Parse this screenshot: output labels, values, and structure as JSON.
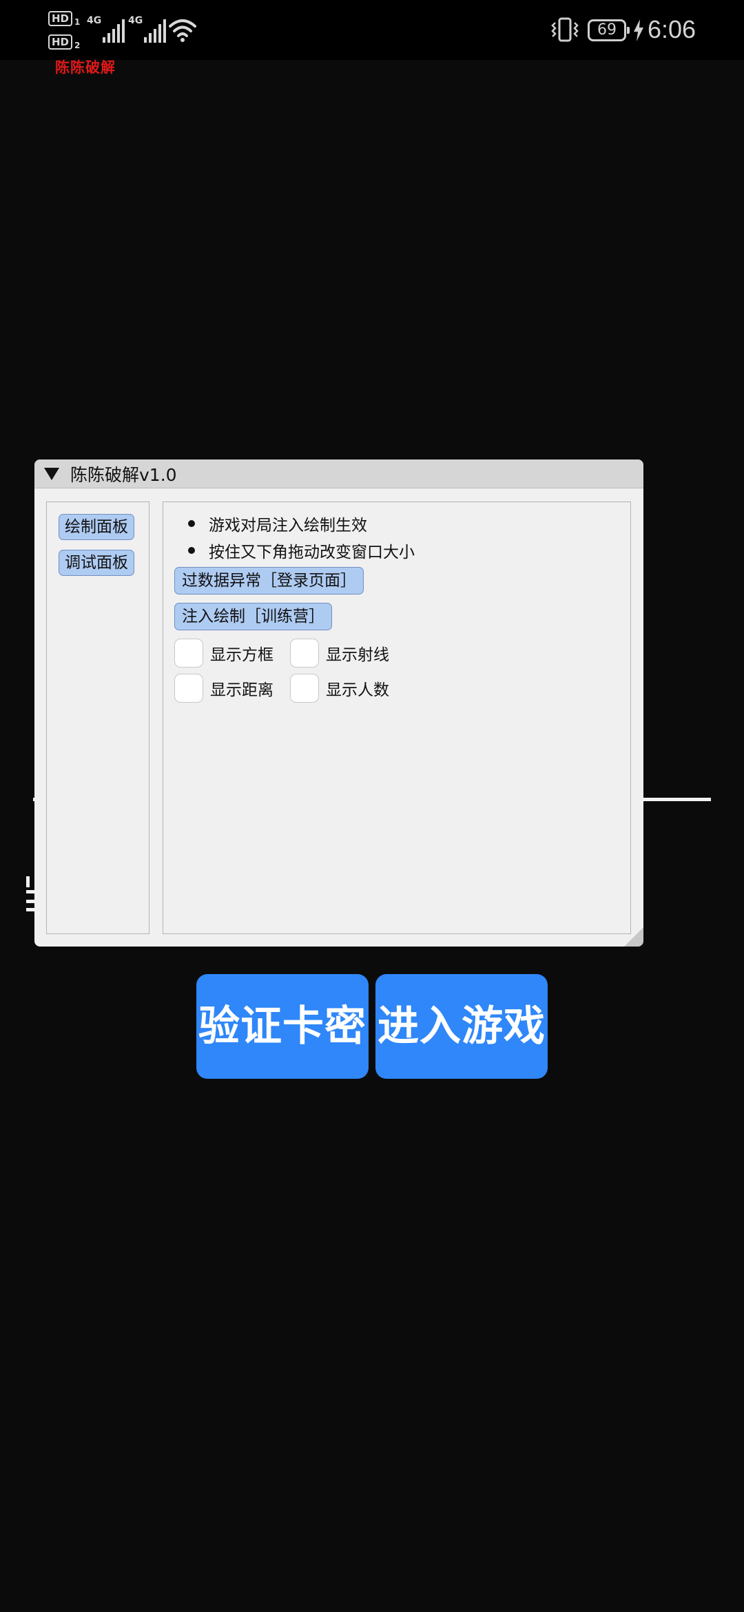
{
  "status_bar": {
    "hd1": "HD",
    "hd1_num": "1",
    "hd2": "HD",
    "hd2_num": "2",
    "sim1_network": "4G",
    "sim2_network": "4G",
    "battery_level": "69",
    "time": "6:06",
    "icons": [
      "signal-icon",
      "wifi-icon",
      "vibrate-icon",
      "battery-icon",
      "charging-icon"
    ],
    "overlay_text": "陈陈破解"
  },
  "window": {
    "title": "陈陈破解v1.0",
    "sidebar": {
      "items": [
        {
          "label": "绘制面板"
        },
        {
          "label": "调试面板"
        }
      ]
    },
    "notes": [
      "游戏对局注入绘制生效",
      "按住又下角拖动改变窗口大小"
    ],
    "buttons": {
      "bypass": "过数据异常［登录页面］",
      "inject": "注入绘制［训练营］"
    },
    "options": [
      {
        "label": "显示方框",
        "checked": false
      },
      {
        "label": "显示射线",
        "checked": false
      },
      {
        "label": "显示距离",
        "checked": false
      },
      {
        "label": "显示人数",
        "checked": false
      }
    ]
  },
  "actions": {
    "verify_label": "验证卡密",
    "enter_label": "进入游戏"
  },
  "colors": {
    "background": "#0b0b0b",
    "window_bg": "#f0f0f0",
    "button_blue": "#2f87f9",
    "small_button": "#aecbf2",
    "overlay_red": "#e01818"
  }
}
